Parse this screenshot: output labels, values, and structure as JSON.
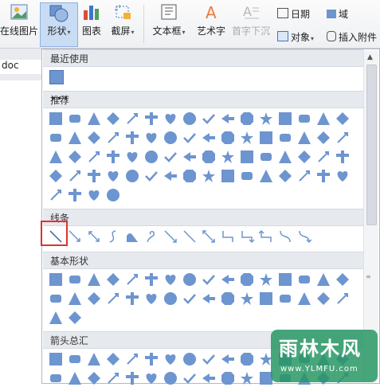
{
  "ribbon": {
    "online_images": "在线图片",
    "shapes": "形状",
    "chart": "图表",
    "screenshot": "截屏",
    "textbox": "文本框",
    "wordart": "艺术字",
    "dropcap": "首字下沉",
    "date": "日期",
    "field": "域",
    "object": "对象",
    "attachment": "插入附件"
  },
  "document": {
    "tab": "doc"
  },
  "panel": {
    "sections": {
      "recent": "最近使用",
      "recommended": "推荐",
      "lines": "线条",
      "basic": "基本形状",
      "arrows": "箭头总汇"
    },
    "more": "•••"
  },
  "colors": {
    "shape": "#6d95cf",
    "shape_dark": "#4f77b3",
    "highlight": "#e03131"
  },
  "watermark": {
    "name": "雨林木风",
    "url": "www.YLMFU.com"
  }
}
